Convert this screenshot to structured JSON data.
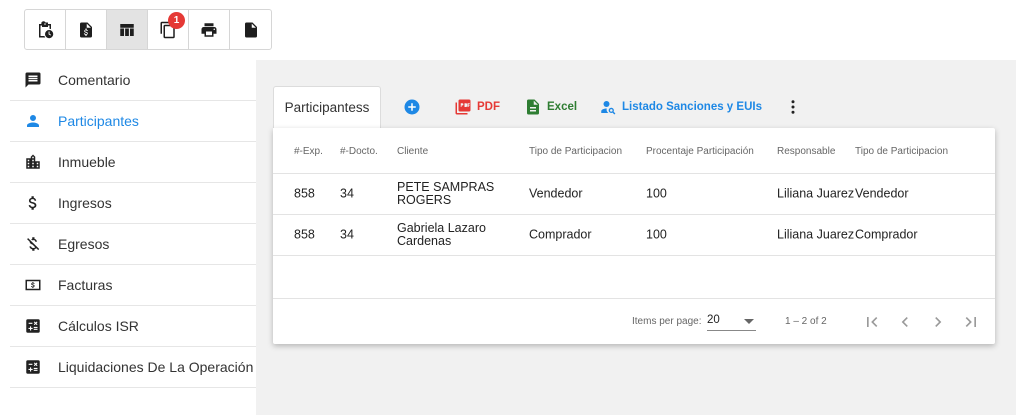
{
  "toolbar": {
    "buttons": [
      {
        "icon": "clipboard-clock-icon"
      },
      {
        "icon": "invoice-dollar-icon"
      },
      {
        "icon": "table-icon",
        "active": true
      },
      {
        "icon": "copy-icon",
        "badge": "1"
      },
      {
        "icon": "printer-icon"
      },
      {
        "icon": "document-icon"
      }
    ]
  },
  "sidebar": {
    "items": [
      {
        "label": "Comentario",
        "icon": "comment-icon"
      },
      {
        "label": "Participantes",
        "icon": "person-icon",
        "active": true
      },
      {
        "label": "Inmueble",
        "icon": "building-icon"
      },
      {
        "label": "Ingresos",
        "icon": "dollar-icon"
      },
      {
        "label": "Egresos",
        "icon": "money-off-icon"
      },
      {
        "label": "Facturas",
        "icon": "bill-icon"
      },
      {
        "label": "Cálculos ISR",
        "icon": "calculator-icon"
      },
      {
        "label": "Liquidaciones De La Operación",
        "icon": "calculator-icon"
      }
    ]
  },
  "tab": {
    "label": "Participantess"
  },
  "actions": {
    "pdf": "PDF",
    "excel": "Excel",
    "listado": "Listado Sanciones y EUIs"
  },
  "colors": {
    "accent": "#1e88e5",
    "pdf": "#e53935",
    "excel": "#2e7d32",
    "badge": "#e53935"
  },
  "table": {
    "headers": [
      "#-Exp.",
      "#-Docto.",
      "Cliente",
      "Tipo de Participacion",
      "Procentaje Participación",
      "Responsable",
      "Tipo de Participacion"
    ],
    "rows": [
      {
        "exp": "858",
        "docto": "34",
        "cliente1": "PETE SAMPRAS",
        "cliente2": "ROGERS",
        "tipo": "Vendedor",
        "pct": "100",
        "resp": "Liliana Juarez",
        "tipo2": "Vendedor"
      },
      {
        "exp": "858",
        "docto": "34",
        "cliente1": "Gabriela Lazaro",
        "cliente2": "Cardenas",
        "tipo": "Comprador",
        "pct": "100",
        "resp": "Liliana Juarez",
        "tipo2": "Comprador"
      }
    ]
  },
  "paginator": {
    "items_per_page_label": "Items per page:",
    "page_size": "20",
    "range": "1 – 2 of 2"
  }
}
